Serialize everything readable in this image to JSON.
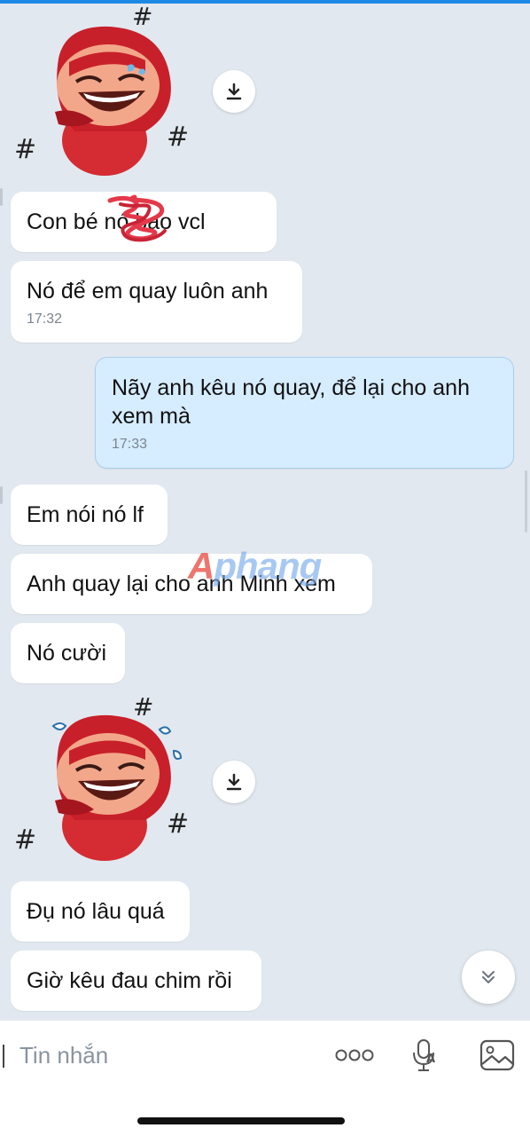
{
  "messages": [
    {
      "text": "Con bé nó bạo vcl"
    },
    {
      "text": "Nó để em quay luôn anh",
      "time": "17:32"
    },
    {
      "text": "Nãy anh kêu nó quay, để lại cho anh xem mà",
      "time": "17:33"
    },
    {
      "text": "Em nói nó lf"
    },
    {
      "text": "Anh quay lại cho anh Minh xem"
    },
    {
      "text": "Nó cười"
    },
    {
      "text": "Đụ nó lâu quá"
    },
    {
      "text": "Giờ kêu đau chim rồi"
    }
  ],
  "input": {
    "placeholder": "Tin nhắn"
  },
  "watermark": {
    "first": "A",
    "rest": "phang"
  },
  "colors": {
    "outgoing_bubble": "#d6ecff",
    "incoming_bubble": "#ffffff",
    "background": "#e2e8ef",
    "sticker_red": "#c8202a"
  },
  "icons": [
    "download-icon",
    "chevron-double-down-icon",
    "more-dots-icon",
    "voice-to-text-icon",
    "gallery-icon"
  ]
}
